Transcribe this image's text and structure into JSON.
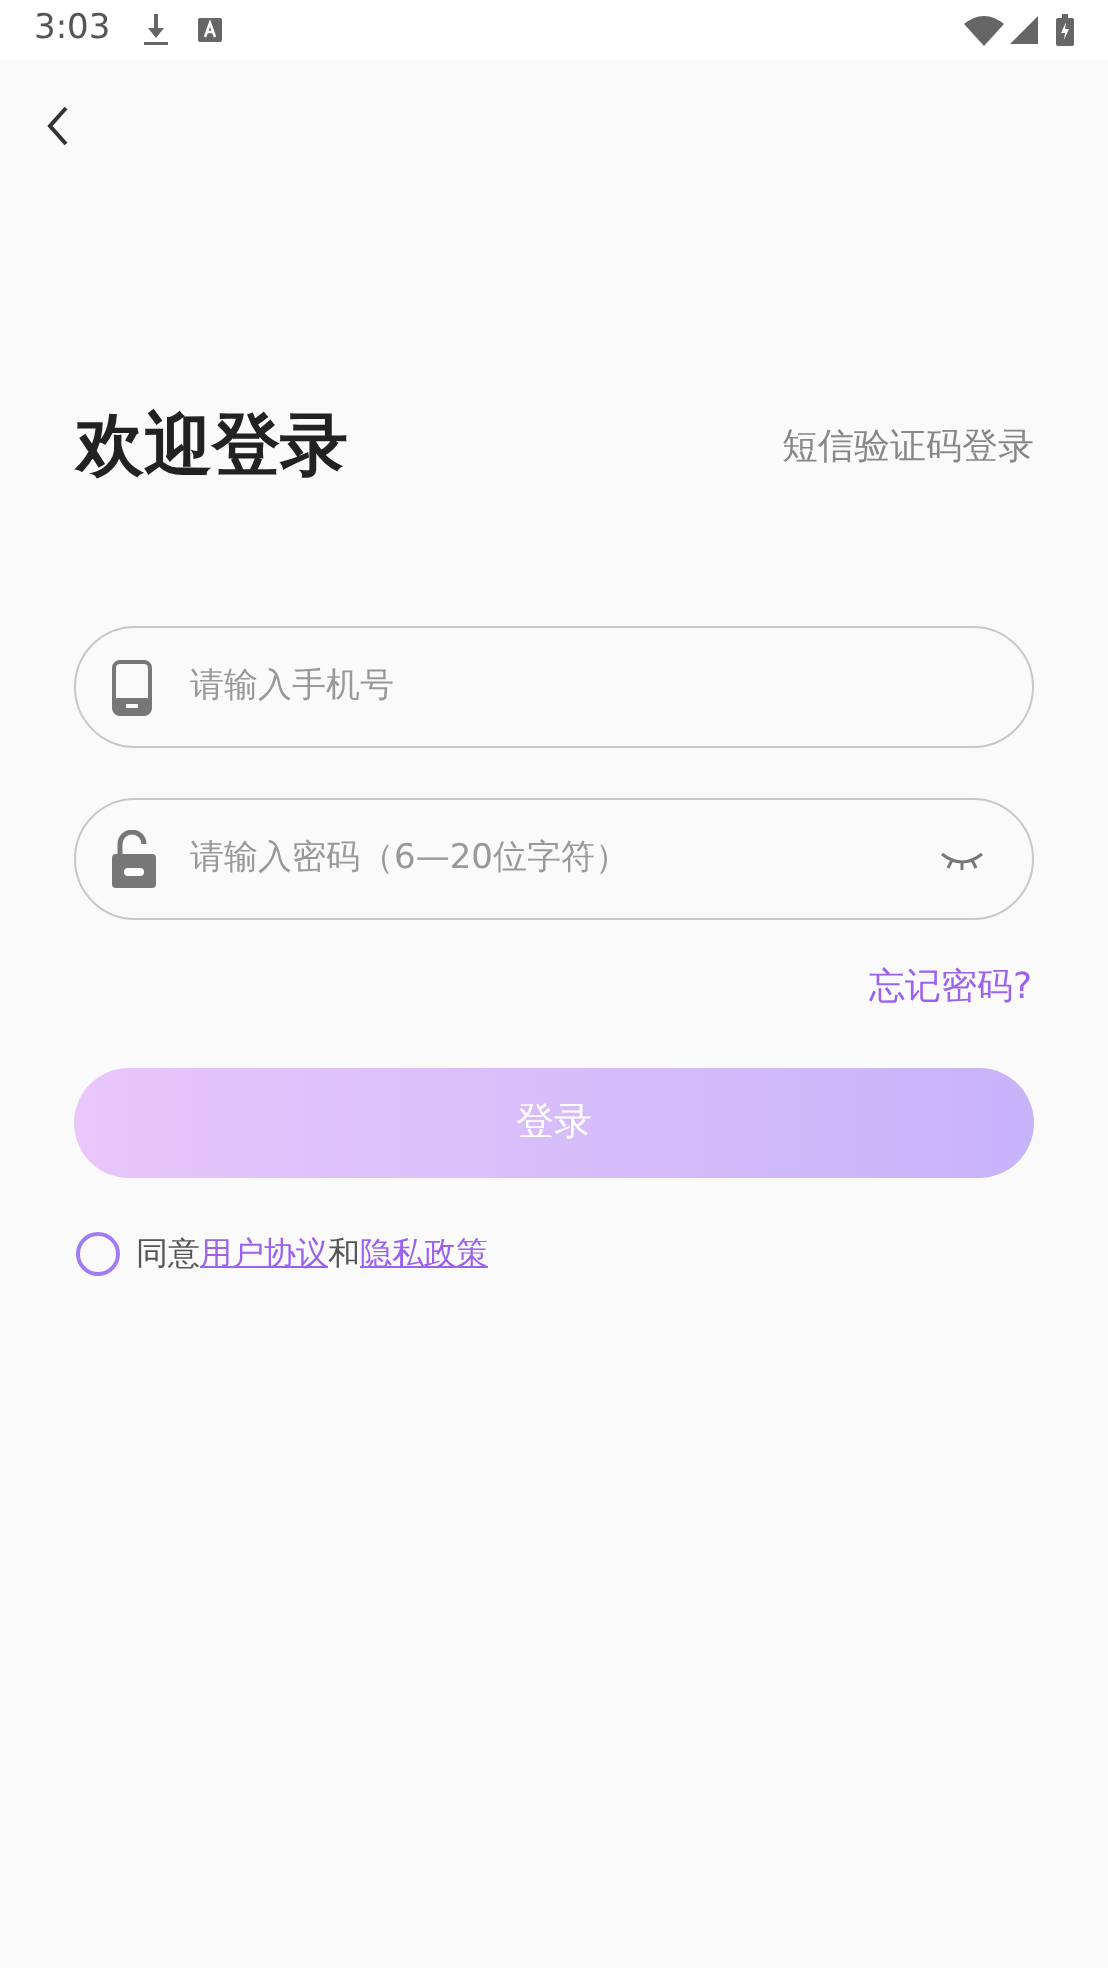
{
  "status_bar": {
    "time": "3:03"
  },
  "header": {
    "title": "欢迎登录",
    "switch_link": "短信验证码登录"
  },
  "phone_field": {
    "placeholder": "请输入手机号"
  },
  "password_field": {
    "placeholder": "请输入密码（6—20位字符）",
    "visible": false
  },
  "forgot_link": "忘记密码?",
  "login_button": {
    "label": "登录",
    "disabled": true
  },
  "agreement": {
    "checked": false,
    "parts": [
      {
        "kind": "text",
        "text": "同意"
      },
      {
        "kind": "link",
        "text": "用户协议"
      },
      {
        "kind": "text",
        "text": "和"
      },
      {
        "kind": "link",
        "text": "隐私政策"
      }
    ]
  }
}
